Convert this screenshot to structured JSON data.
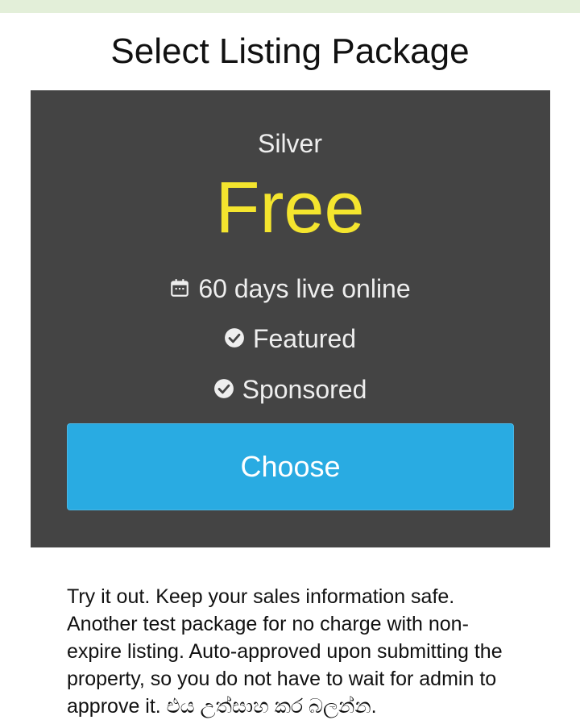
{
  "page": {
    "title": "Select Listing Package"
  },
  "package": {
    "tier": "Silver",
    "price": "Free",
    "features": [
      {
        "icon": "calendar-icon",
        "label": "60 days live online"
      },
      {
        "icon": "check-circle-icon",
        "label": "Featured"
      },
      {
        "icon": "check-circle-icon",
        "label": "Sponsored"
      }
    ],
    "button_label": "Choose"
  },
  "description": "Try it out. Keep your sales information safe. Another test package for no charge with non-expire listing. Auto-approved upon submitting the property, so you do not have to wait for admin to approve it. එය උත්සාහ කර බලන්න.",
  "colors": {
    "top_strip": "#e3efd9",
    "card_background": "#444444",
    "price": "#f4e52e",
    "button": "#29abe2"
  }
}
